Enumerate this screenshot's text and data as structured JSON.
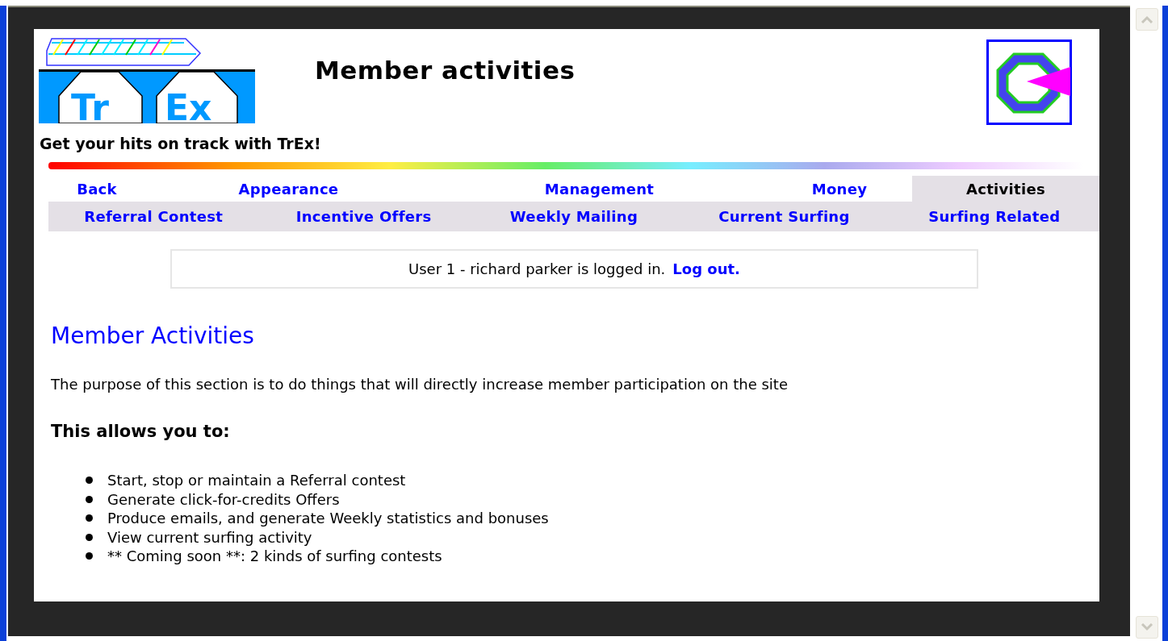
{
  "header": {
    "title": "Member activities",
    "tagline": "Get your hits on track with TrEx!",
    "logo_text": [
      "Tr",
      "Ex"
    ]
  },
  "tabs": [
    {
      "label": "Back",
      "selected": false
    },
    {
      "label": "Appearance",
      "selected": false
    },
    {
      "label": "Management",
      "selected": false
    },
    {
      "label": "Money",
      "selected": false
    },
    {
      "label": "Activities",
      "selected": true
    }
  ],
  "subtabs": [
    "Referral Contest",
    "Incentive Offers",
    "Weekly Mailing",
    "Current Surfing",
    "Surfing Related"
  ],
  "login": {
    "text": "User 1 - richard parker is logged in.",
    "link": "Log out."
  },
  "section": {
    "heading": "Member Activities",
    "intro": "The purpose of this section is to do things that will directly increase member participation on the site",
    "subheading": "This allows you to:",
    "items": [
      "Start, stop or maintain a Referral contest",
      "Generate click-for-credits Offers",
      "Produce emails, and generate Weekly statistics and bonuses",
      "View current surfing activity",
      "** Coming soon **: 2 kinds of surfing contests"
    ]
  }
}
